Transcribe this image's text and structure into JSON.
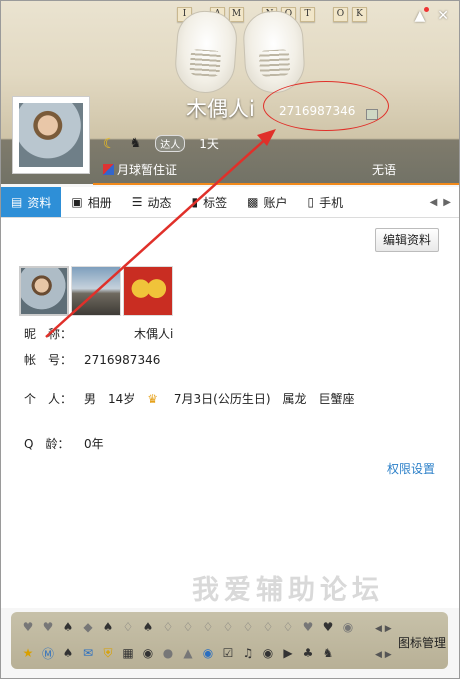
{
  "header": {
    "tiles": [
      "I",
      "A",
      "M",
      "N",
      "O",
      "T",
      "O",
      "K"
    ],
    "nickname": "木偶人i",
    "qq_number": "2716987346",
    "badge_label": "达人",
    "days": "1天",
    "certificate": "月球暂住证",
    "signature": "无语"
  },
  "tabs": [
    {
      "label": "资料",
      "icon": "id-card-icon"
    },
    {
      "label": "相册",
      "icon": "photo-album-icon"
    },
    {
      "label": "动态",
      "icon": "feed-icon"
    },
    {
      "label": "标签",
      "icon": "bookmark-icon"
    },
    {
      "label": "账户",
      "icon": "wallet-icon"
    },
    {
      "label": "手机",
      "icon": "phone-icon"
    }
  ],
  "profile": {
    "edit_button": "编辑资料",
    "nickname_label": "昵　称：",
    "nickname_value": "木偶人i",
    "account_label": "帐　号：",
    "account_value": "2716987346",
    "personal_label": "个　人：",
    "gender": "男",
    "age": "14岁",
    "birthday": "7月3日(公历生日)",
    "zodiac": "属龙",
    "constellation": "巨蟹座",
    "qage_label": "Q　龄：",
    "qage_value": "0年",
    "permission_link": "权限设置"
  },
  "watermark": "我爱辅助论坛",
  "iconbar": {
    "manage_label": "图标管理"
  },
  "colors": {
    "tab_active": "#2e8fd7",
    "accent_line": "#f28a1b",
    "annotation": "#e0302a",
    "link": "#2b7fc8"
  }
}
